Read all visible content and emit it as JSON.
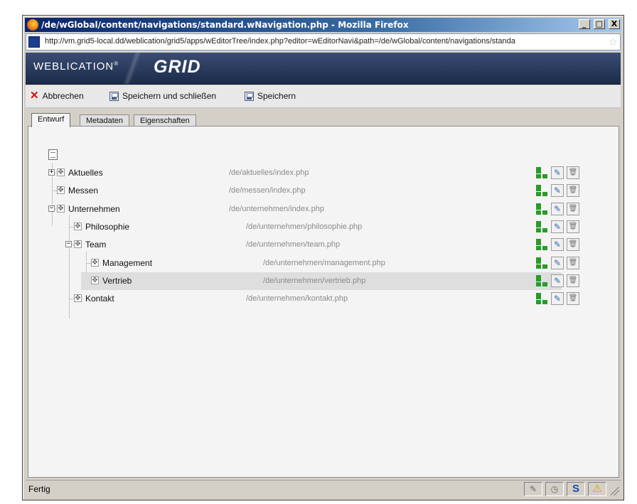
{
  "window": {
    "title": "/de/wGlobal/content/navigations/standard.wNavigation.php - Mozilla Firefox",
    "controls": {
      "minimize": "_",
      "maximize": "□",
      "close": "X"
    }
  },
  "address_bar": {
    "url": "http://vm.grid5-local.dd/weblication/grid5/apps/wEditorTree/index.php?editor=wEditorNavi&path=/de/wGlobal/content/navigations/standa"
  },
  "app": {
    "brand": "WEBLICATION",
    "brand_mark": "®",
    "product": "GRID"
  },
  "toolbar": {
    "cancel_label": "Abbrechen",
    "save_close_label": "Speichern und schließen",
    "save_label": "Speichern"
  },
  "tabs": [
    {
      "label": "Entwurf",
      "active": true
    },
    {
      "label": "Metadaten",
      "active": false
    },
    {
      "label": "Eigenschaften",
      "active": false
    }
  ],
  "tree": [
    {
      "label": "Aktuelles",
      "path": "/de/aktuelles/index.php",
      "level": 0,
      "expander": "+",
      "selected": false
    },
    {
      "label": "Messen",
      "path": "/de/messen/index.php",
      "level": 0,
      "expander": "",
      "selected": false
    },
    {
      "label": "Unternehmen",
      "path": "/de/unternehmen/index.php",
      "level": 0,
      "expander": "−",
      "selected": false
    },
    {
      "label": "Philosophie",
      "path": "/de/unternehmen/philosophie.php",
      "level": 1,
      "expander": "",
      "selected": false
    },
    {
      "label": "Team",
      "path": "/de/unternehmen/team.php",
      "level": 1,
      "expander": "−",
      "selected": false
    },
    {
      "label": "Management",
      "path": "/de/unternehmen/management.php",
      "level": 2,
      "expander": "",
      "selected": false
    },
    {
      "label": "Vertrieb",
      "path": "/de/unternehmen/vertrieb.php",
      "level": 2,
      "expander": "",
      "selected": true
    },
    {
      "label": "Kontakt",
      "path": "/de/unternehmen/kontakt.php",
      "level": 1,
      "expander": "",
      "selected": false
    }
  ],
  "status": {
    "text": "Fertig",
    "icons": [
      "plugin-icon",
      "clock-icon",
      "s-icon",
      "warning-icon"
    ],
    "s_glyph": "S",
    "warning_glyph": "⚠"
  },
  "colors": {
    "titlebar_start": "#0a246a",
    "app_header": "#2a3a5c",
    "tree_action_green": "#2a9a2a",
    "path_gray": "#8a8a8a"
  }
}
